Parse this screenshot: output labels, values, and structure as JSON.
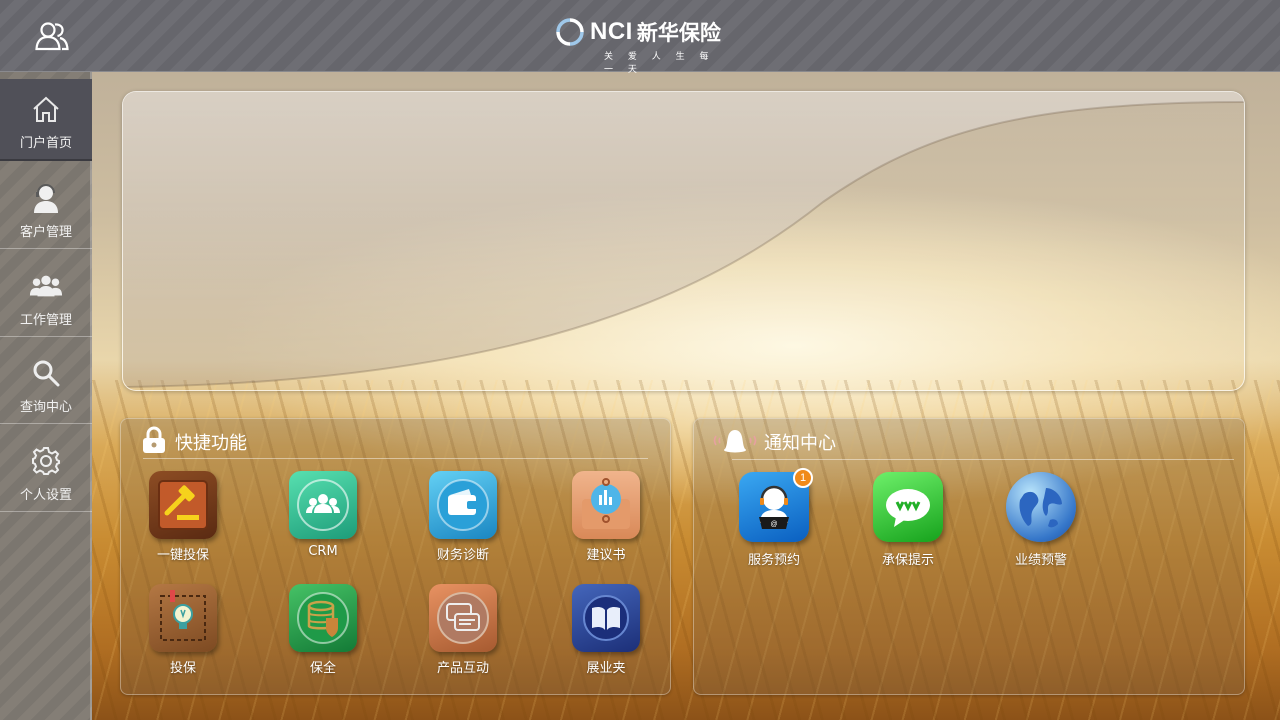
{
  "brand": {
    "name_en": "NCI",
    "name_cn": "新华保险",
    "slogan": "关 爱 人 生 每 一 天"
  },
  "topbar": {
    "user_icon": "users-icon"
  },
  "sidebar": {
    "items": [
      {
        "label": "门户首页",
        "icon": "home-icon",
        "active": true
      },
      {
        "label": "客户管理",
        "icon": "customer-service-icon",
        "active": false
      },
      {
        "label": "工作管理",
        "icon": "team-icon",
        "active": false
      },
      {
        "label": "查询中心",
        "icon": "search-icon",
        "active": false
      },
      {
        "label": "个人设置",
        "icon": "gear-icon",
        "active": false
      }
    ]
  },
  "quick": {
    "title": "快捷功能",
    "icon": "lock-icon",
    "items": [
      {
        "label": "一键投保",
        "icon": "gavel-icon"
      },
      {
        "label": "CRM",
        "icon": "crm-people-icon"
      },
      {
        "label": "财务诊断",
        "icon": "wallet-icon"
      },
      {
        "label": "建议书",
        "icon": "proposal-chart-icon"
      },
      {
        "label": "投保",
        "icon": "lightbulb-icon"
      },
      {
        "label": "保全",
        "icon": "database-shield-icon"
      },
      {
        "label": "产品互动",
        "icon": "chat-bubbles-icon"
      },
      {
        "label": "展业夹",
        "icon": "book-icon"
      }
    ]
  },
  "notice": {
    "title": "通知中心",
    "icon": "bell-icon",
    "items": [
      {
        "label": "服务预约",
        "icon": "agent-icon",
        "badge": "1"
      },
      {
        "label": "承保提示",
        "icon": "message-icon"
      },
      {
        "label": "业绩预警",
        "icon": "globe-icon"
      }
    ]
  },
  "colors": {
    "topbar": "#6a6a70",
    "sidebar_active": "#505058",
    "badge": "#f08a1a"
  }
}
